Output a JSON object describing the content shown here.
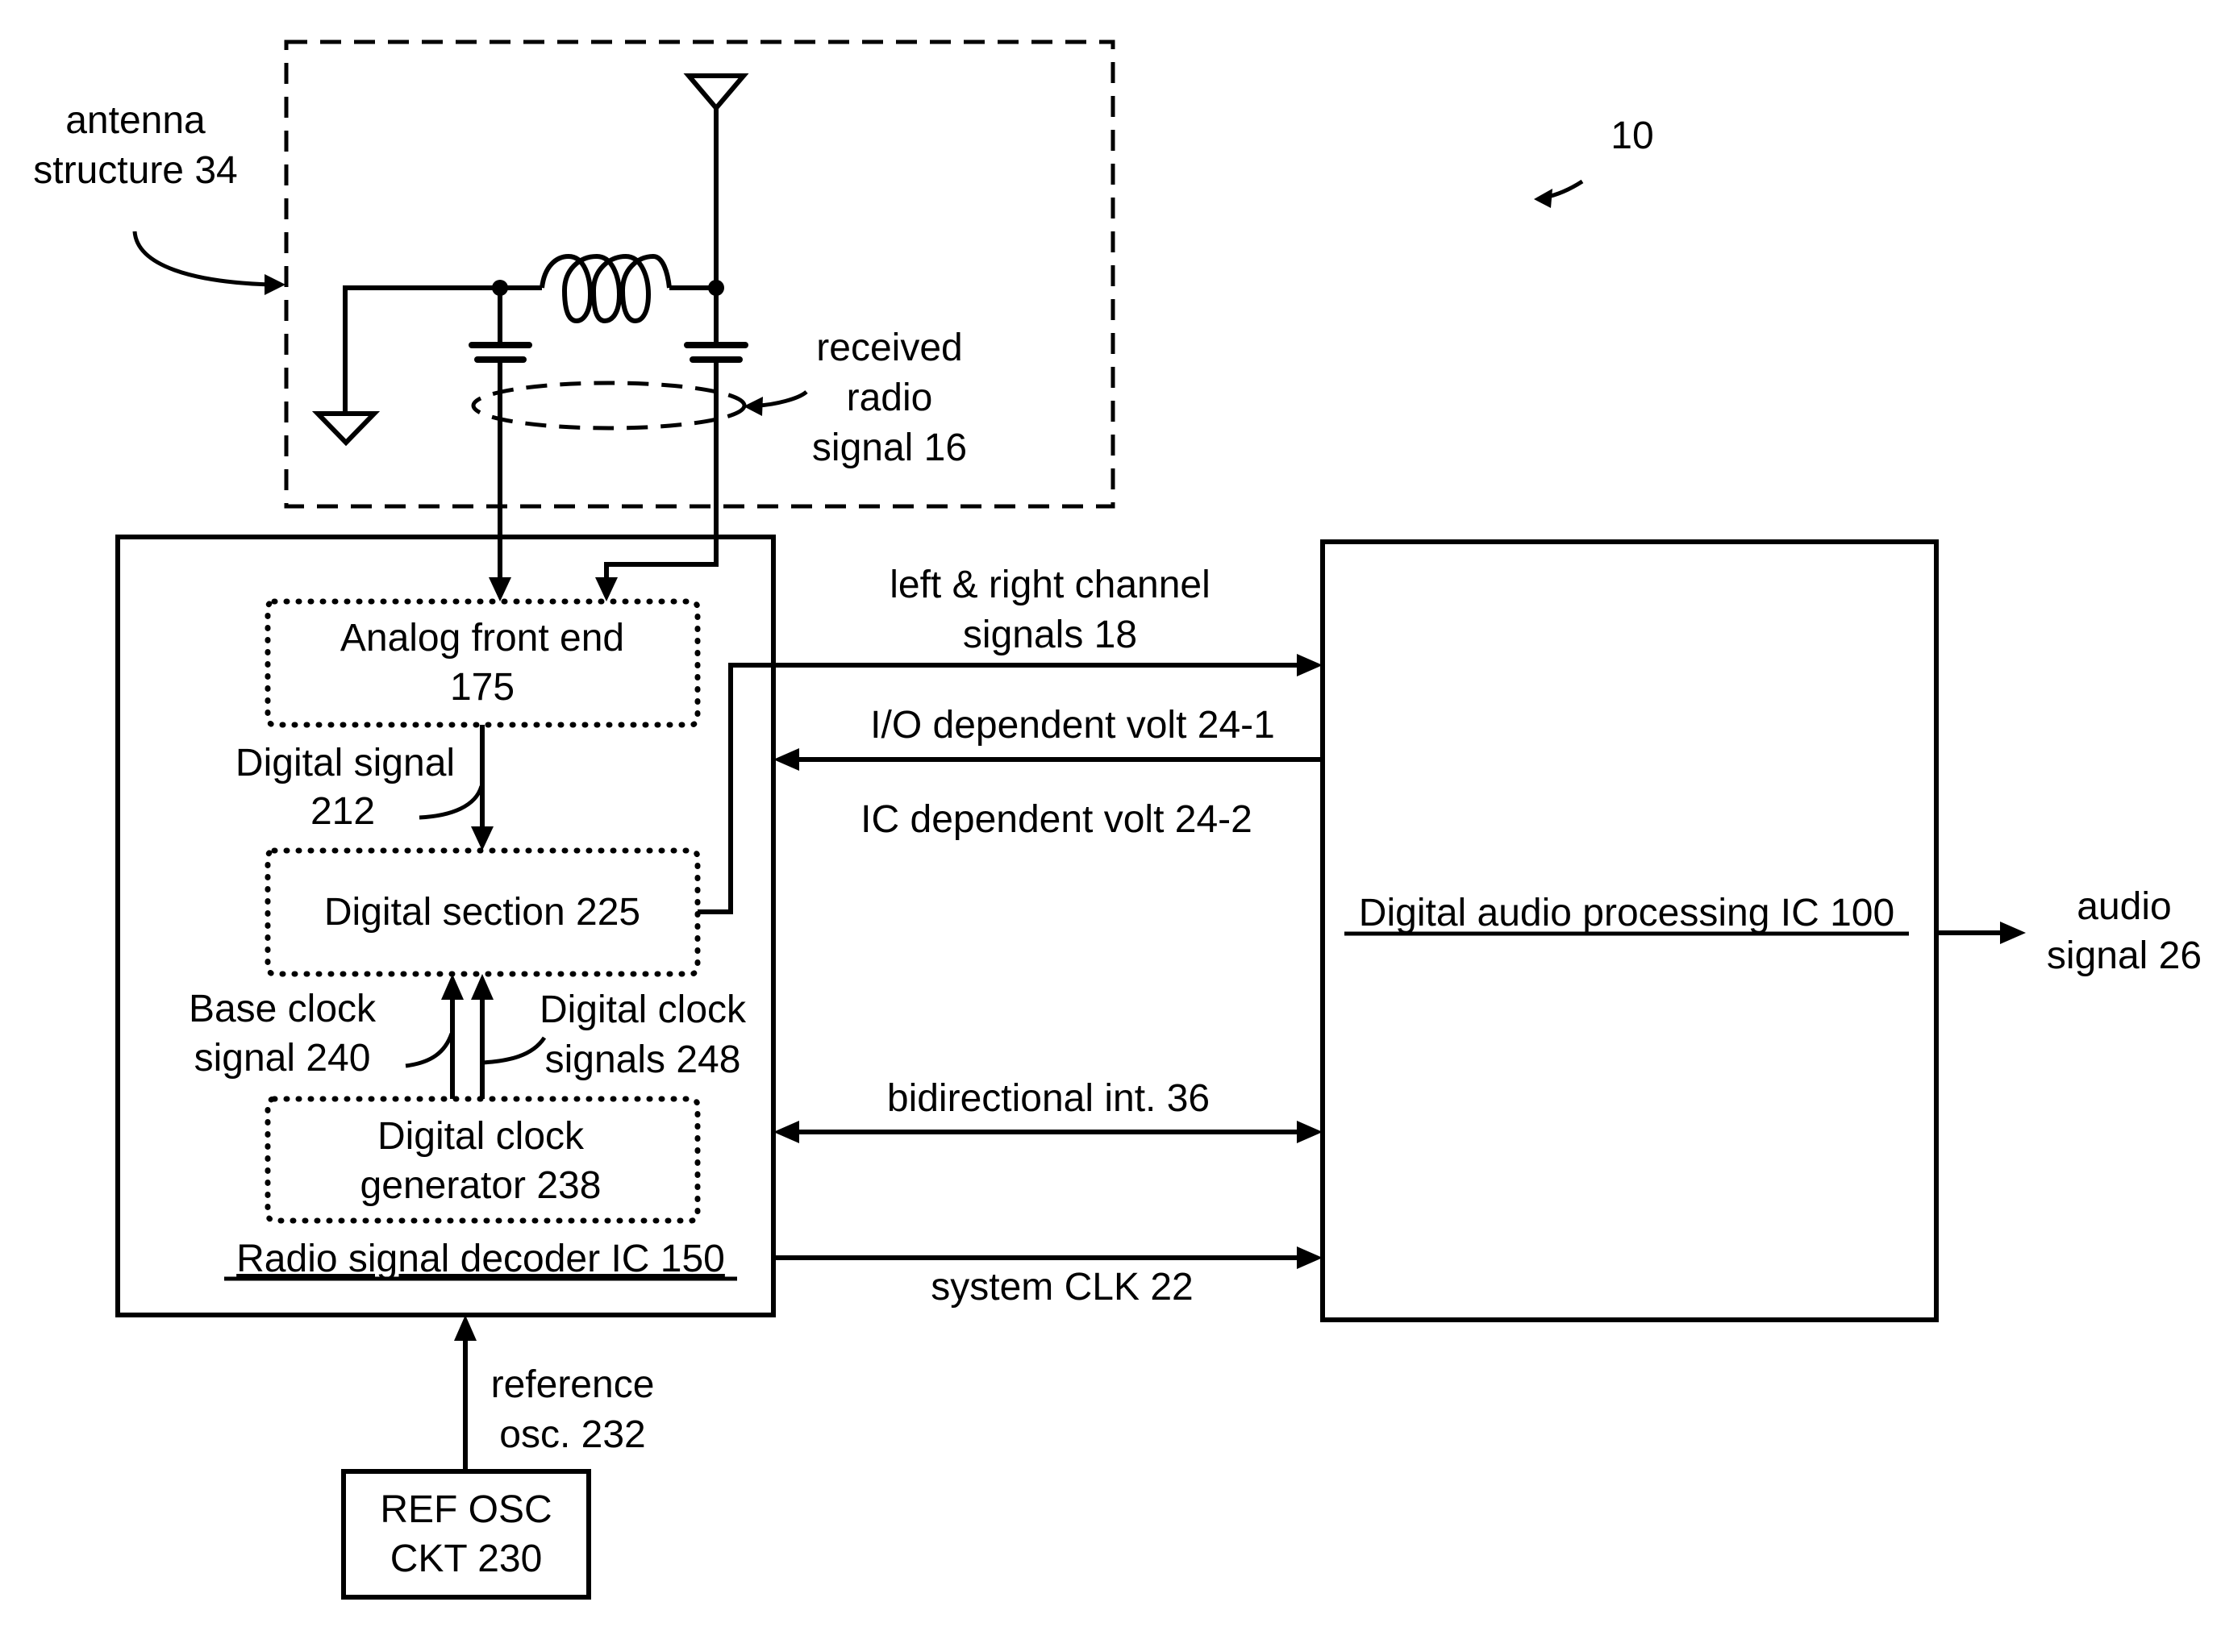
{
  "figure": {
    "reference_numeral": "10",
    "colors": {
      "ink": "#000000",
      "background": "#ffffff"
    }
  },
  "antenna_structure": {
    "label_line1": "antenna",
    "label_line2": "structure 34"
  },
  "received_signal": {
    "line1": "received",
    "line2": "radio",
    "line3": "signal 16"
  },
  "decoder_ic": {
    "title": "Radio signal decoder IC 150",
    "analog_front_end": {
      "line1": "Analog front end",
      "line2": "175"
    },
    "digital_signal": {
      "line1": "Digital signal",
      "line2": "212"
    },
    "digital_section": {
      "label": "Digital section 225"
    },
    "base_clock": {
      "line1": "Base clock",
      "line2": "signal 240"
    },
    "digital_clock_signals": {
      "line1": "Digital clock",
      "line2": "signals 248"
    },
    "clock_generator": {
      "line1": "Digital clock",
      "line2": "generator 238"
    }
  },
  "audio_ic": {
    "title": "Digital audio processing IC 100"
  },
  "interconnects": {
    "lr_channel": {
      "line1": "left & right channel",
      "line2": "signals 18"
    },
    "io_volt": "I/O dependent volt 24-1",
    "ic_volt": "IC dependent volt 24-2",
    "bidirectional": "bidirectional int. 36",
    "system_clk": "system CLK 22"
  },
  "output": {
    "line1": "audio",
    "line2": "signal 26"
  },
  "reference_osc": {
    "signal": {
      "line1": "reference",
      "line2": "osc. 232"
    },
    "block": {
      "line1": "REF OSC",
      "line2": "CKT 230"
    }
  }
}
